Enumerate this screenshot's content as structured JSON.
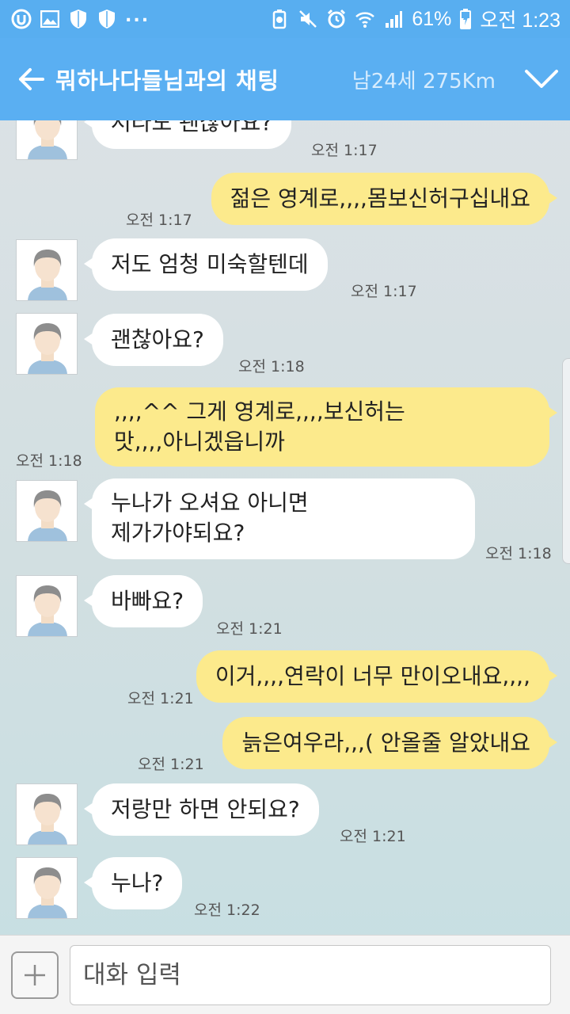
{
  "status_bar": {
    "more_indicator": "...",
    "battery_percent": "61%",
    "clock": "오전 1:23"
  },
  "header": {
    "back_icon": "back-arrow-icon",
    "title": "뭐하나다들님과의 채팅",
    "user_info": "남24세 275Km",
    "collapse_icon": "chevron-down-icon"
  },
  "colors": {
    "header_bg": "#5aaff2",
    "incoming_bubble": "#ffffff",
    "outgoing_bubble": "#fcea8c"
  },
  "messages": [
    {
      "direction": "in",
      "text": "저라도 괜찮아요?",
      "time": "오전 1:17"
    },
    {
      "direction": "out",
      "text": "젊은 영계로,,,,몸보신허구십내요",
      "time": "오전 1:17"
    },
    {
      "direction": "in",
      "text": "저도 엄청 미숙할텐데",
      "time": "오전 1:17"
    },
    {
      "direction": "in",
      "text": "괜찮아요?",
      "time": "오전 1:18"
    },
    {
      "direction": "out",
      "text": ",,,,^^ 그게 영계로,,,,보신허는\n맛,,,,아니겠읍니까",
      "time": "오전 1:18"
    },
    {
      "direction": "in",
      "text": "누나가 오셔요 아니면\n제가가야되요?",
      "time": "오전 1:18"
    },
    {
      "direction": "in",
      "text": "바빠요?",
      "time": "오전 1:21"
    },
    {
      "direction": "out",
      "text": "이거,,,,연락이 너무 만이오내요,,,,",
      "time": "오전 1:21"
    },
    {
      "direction": "out",
      "text": "늙은여우라,,,( 안올줄 알았내요",
      "time": "오전 1:21"
    },
    {
      "direction": "in",
      "text": "저랑만 하면 안되요?",
      "time": "오전 1:21"
    },
    {
      "direction": "in",
      "text": "누나?",
      "time": "오전 1:22"
    }
  ],
  "input_bar": {
    "attach_icon": "plus-icon",
    "placeholder": "대화 입력",
    "value": ""
  }
}
